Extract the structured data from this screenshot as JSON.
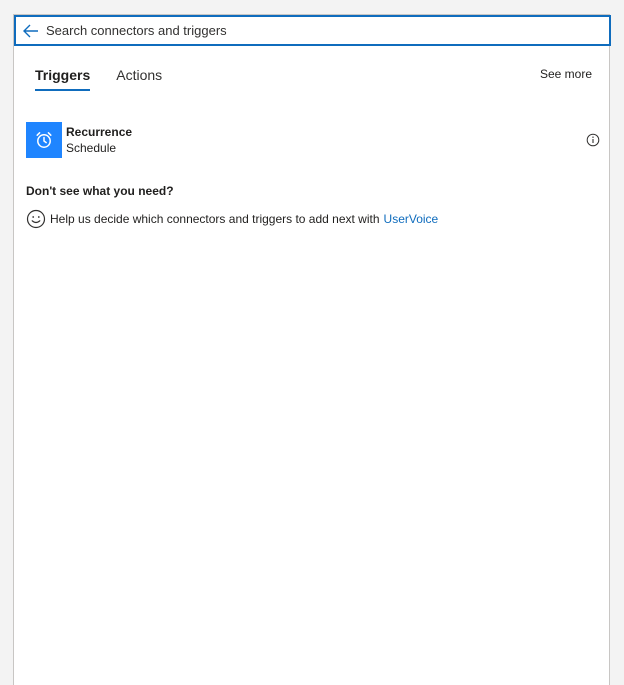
{
  "search": {
    "placeholder": "Search connectors and triggers"
  },
  "tabs": [
    {
      "label": "Triggers",
      "active": true
    },
    {
      "label": "Actions",
      "active": false
    }
  ],
  "see_more": "See more",
  "triggers": [
    {
      "name": "Recurrence",
      "connector": "Schedule",
      "icon": "alarm-clock-icon",
      "icon_color": "#1f85ff"
    }
  ],
  "help": {
    "heading": "Don't see what you need?",
    "text": "Help us decide which connectors and triggers to add next with",
    "link": "UserVoice"
  },
  "colors": {
    "accent": "#0f6cbd",
    "trigger_icon_bg": "#1f85ff"
  }
}
